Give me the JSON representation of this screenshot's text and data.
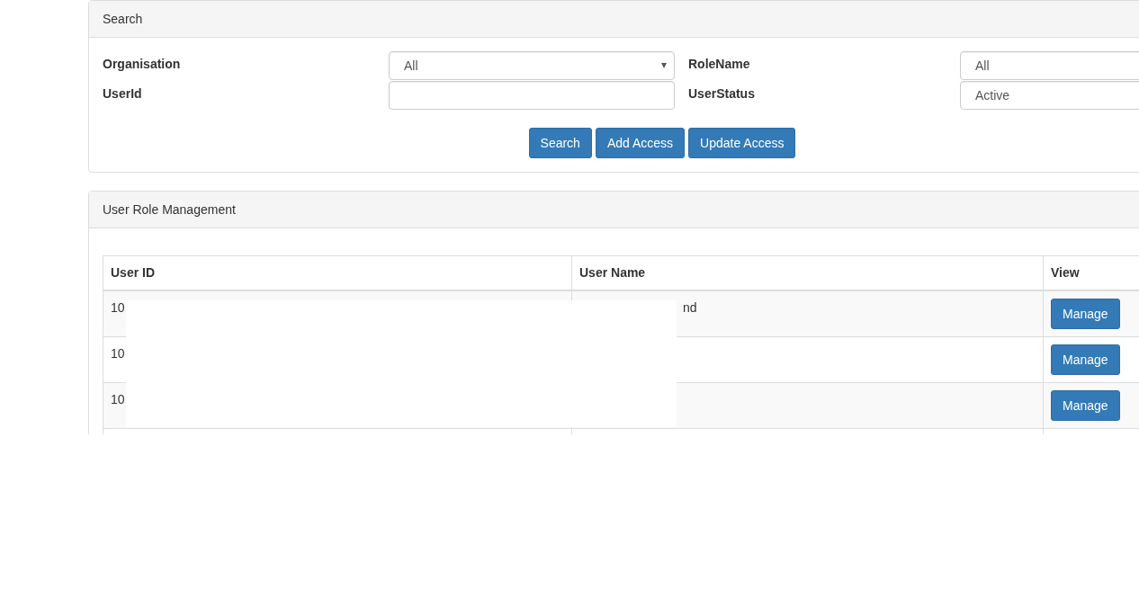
{
  "search_panel": {
    "title": "Search",
    "fields": [
      {
        "label": "Organisation",
        "kind": "select",
        "value": "All"
      },
      {
        "label": "RoleName",
        "kind": "input",
        "value": "All"
      },
      {
        "label": "UserId",
        "kind": "input"
      },
      {
        "label": "UserStatus",
        "kind": "input",
        "value": "Active"
      }
    ],
    "buttons": [
      "Search",
      "Add Access",
      "Update Access"
    ]
  },
  "table_panel": {
    "title": "User Role Management",
    "columns": [
      "User ID",
      "User Name",
      "View"
    ],
    "rows": [
      {
        "user_id": "10",
        "user_name": "nd",
        "action": "Manage"
      },
      {
        "user_id": "10",
        "action": "Manage"
      },
      {
        "user_id": "10",
        "action": "Manage"
      }
    ]
  }
}
